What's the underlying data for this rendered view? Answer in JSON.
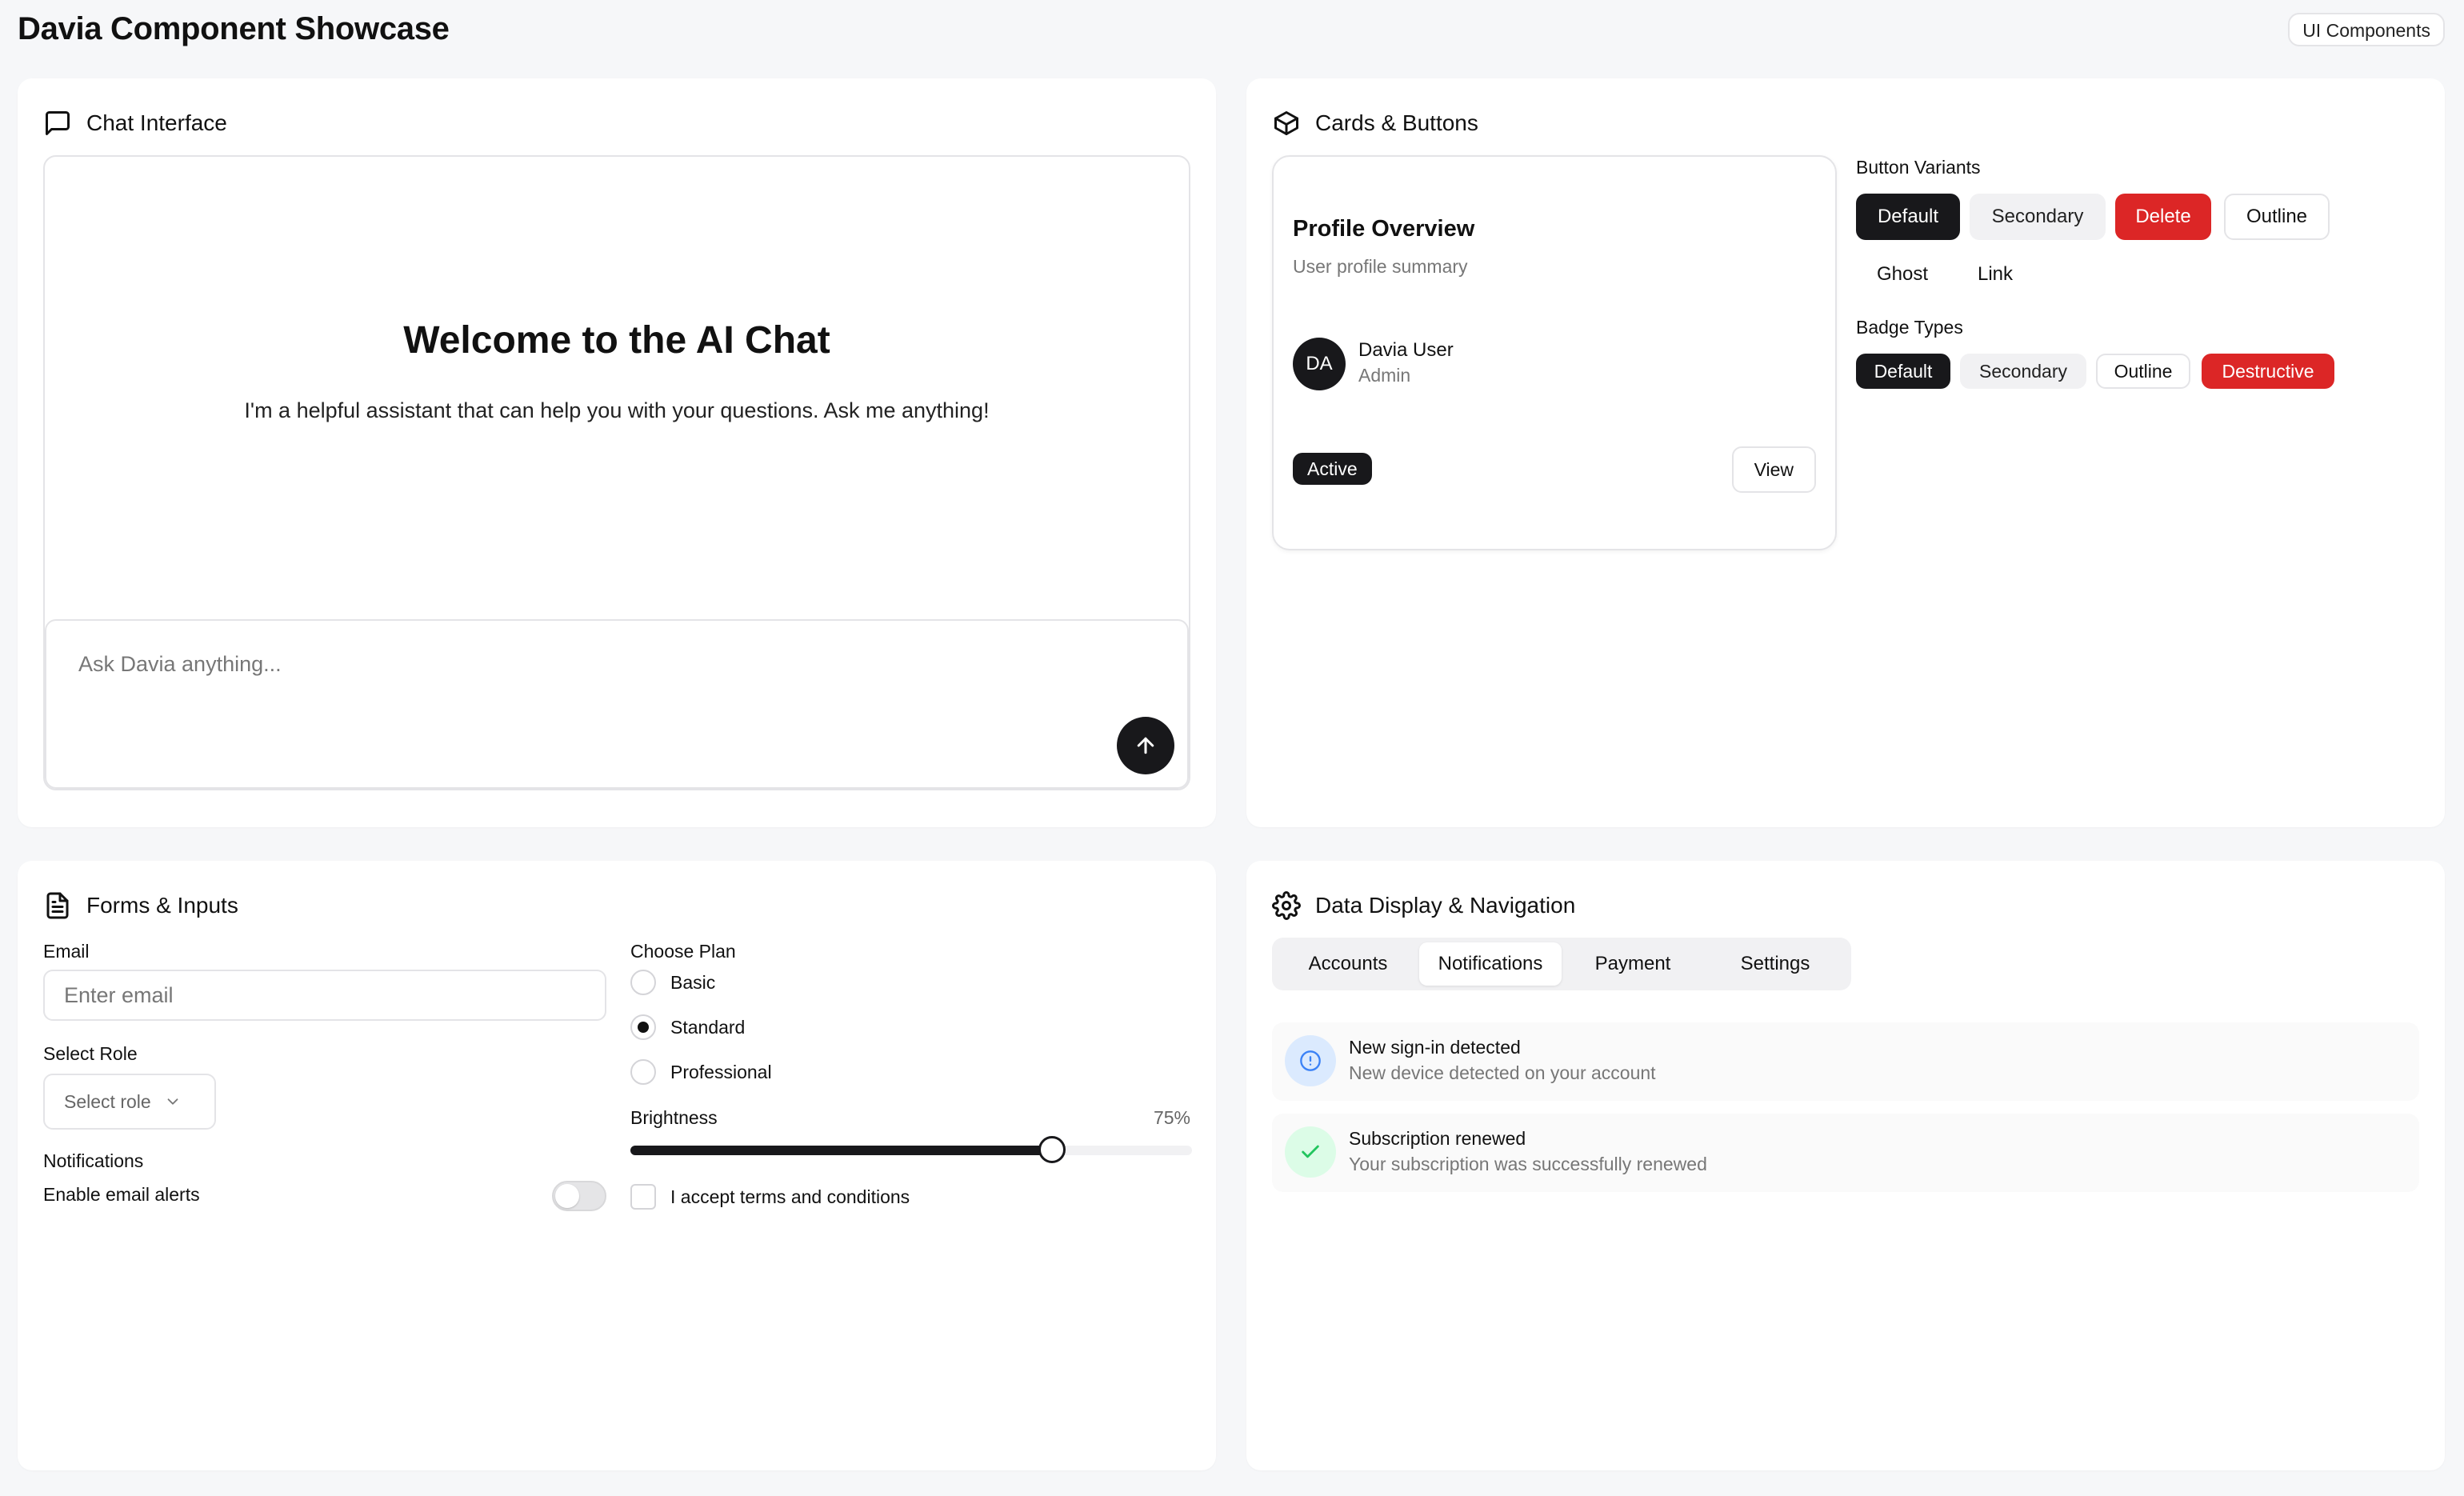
{
  "header": {
    "title": "Davia Component Showcase",
    "badge": "UI Components"
  },
  "chat": {
    "panel_title": "Chat Interface",
    "welcome": "Welcome to the AI Chat",
    "subtitle": "I'm a helpful assistant that can help you with your questions. Ask me anything!",
    "input_placeholder": "Ask Davia anything...",
    "icons": {
      "panel": "message-square-icon",
      "send": "arrow-up-icon"
    }
  },
  "cards": {
    "panel_title": "Cards & Buttons",
    "profile": {
      "title": "Profile Overview",
      "subtitle": "User profile summary",
      "avatar_initials": "DA",
      "name": "Davia User",
      "role": "Admin",
      "status_badge": "Active",
      "view_button": "View"
    },
    "button_variants_label": "Button Variants",
    "buttons": {
      "default": "Default",
      "secondary": "Secondary",
      "delete": "Delete",
      "outline": "Outline",
      "ghost": "Ghost",
      "link": "Link"
    },
    "badge_types_label": "Badge Types",
    "badges": {
      "default": "Default",
      "secondary": "Secondary",
      "outline": "Outline",
      "destructive": "Destructive"
    },
    "icons": {
      "panel": "box-icon"
    }
  },
  "forms": {
    "panel_title": "Forms & Inputs",
    "email_label": "Email",
    "email_placeholder": "Enter email",
    "email_value": "",
    "role_label": "Select Role",
    "role_placeholder": "Select role",
    "notifications_label": "Notifications",
    "email_alerts_label": "Enable email alerts",
    "email_alerts_enabled": false,
    "plan_label": "Choose Plan",
    "plans": [
      "Basic",
      "Standard",
      "Professional"
    ],
    "selected_plan": "Standard",
    "brightness_label": "Brightness",
    "brightness_value": 75,
    "brightness_display": "75%",
    "terms_label": "I accept terms and conditions",
    "terms_accepted": false,
    "icons": {
      "panel": "file-text-icon",
      "select": "chevron-down-icon"
    }
  },
  "data": {
    "panel_title": "Data Display & Navigation",
    "tabs": [
      "Accounts",
      "Notifications",
      "Payment",
      "Settings"
    ],
    "active_tab": "Notifications",
    "notifications": [
      {
        "title": "New sign-in detected",
        "description": "New device detected on your account",
        "icon": "info-icon",
        "color": "#3b82f6"
      },
      {
        "title": "Subscription renewed",
        "description": "Your subscription was successfully renewed",
        "icon": "check-icon",
        "color": "#22c55e"
      }
    ],
    "icons": {
      "panel": "settings-icon"
    }
  },
  "colors": {
    "primary": "#18181b",
    "destructive": "#dc2626",
    "background": "#f6f7f9"
  }
}
